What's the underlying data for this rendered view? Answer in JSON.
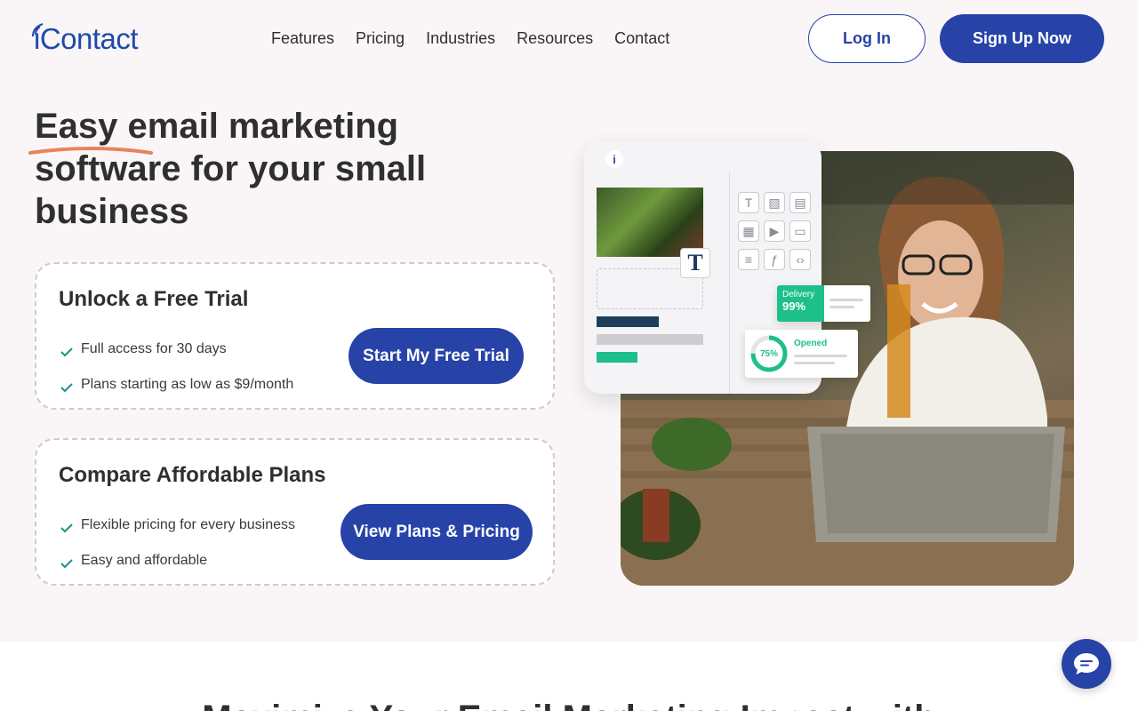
{
  "header": {
    "logo_text": "iContact",
    "nav": [
      "Features",
      "Pricing",
      "Industries",
      "Resources",
      "Contact"
    ],
    "login_label": "Log In",
    "signup_label": "Sign Up Now"
  },
  "hero": {
    "title": "Easy email marketing software for your small business"
  },
  "cards": [
    {
      "title": "Unlock a Free Trial",
      "items": [
        "Full access for 30 days",
        "Plans starting as low as $9/month"
      ],
      "button": "Start My Free Trial"
    },
    {
      "title": "Compare Affordable Plans",
      "items": [
        "Flexible pricing for every business",
        "Easy and affordable"
      ],
      "button": "View Plans & Pricing"
    }
  ],
  "illustration": {
    "editor_logo": "i",
    "text_tool": "T",
    "delivery_label": "Delivery",
    "delivery_value": "99%",
    "opened_label": "Opened",
    "opened_value": "75%",
    "opened_fraction": 0.75
  },
  "lower": {
    "title": "Maximize Your Email Marketing Impact with"
  },
  "colors": {
    "brand_blue": "#2743a8",
    "accent_green": "#1dbf8a",
    "underline_orange": "#e8845a",
    "check_teal": "#1a8f8a"
  },
  "icons": {
    "chat": "chat-bubble-icon",
    "check": "check-icon"
  }
}
